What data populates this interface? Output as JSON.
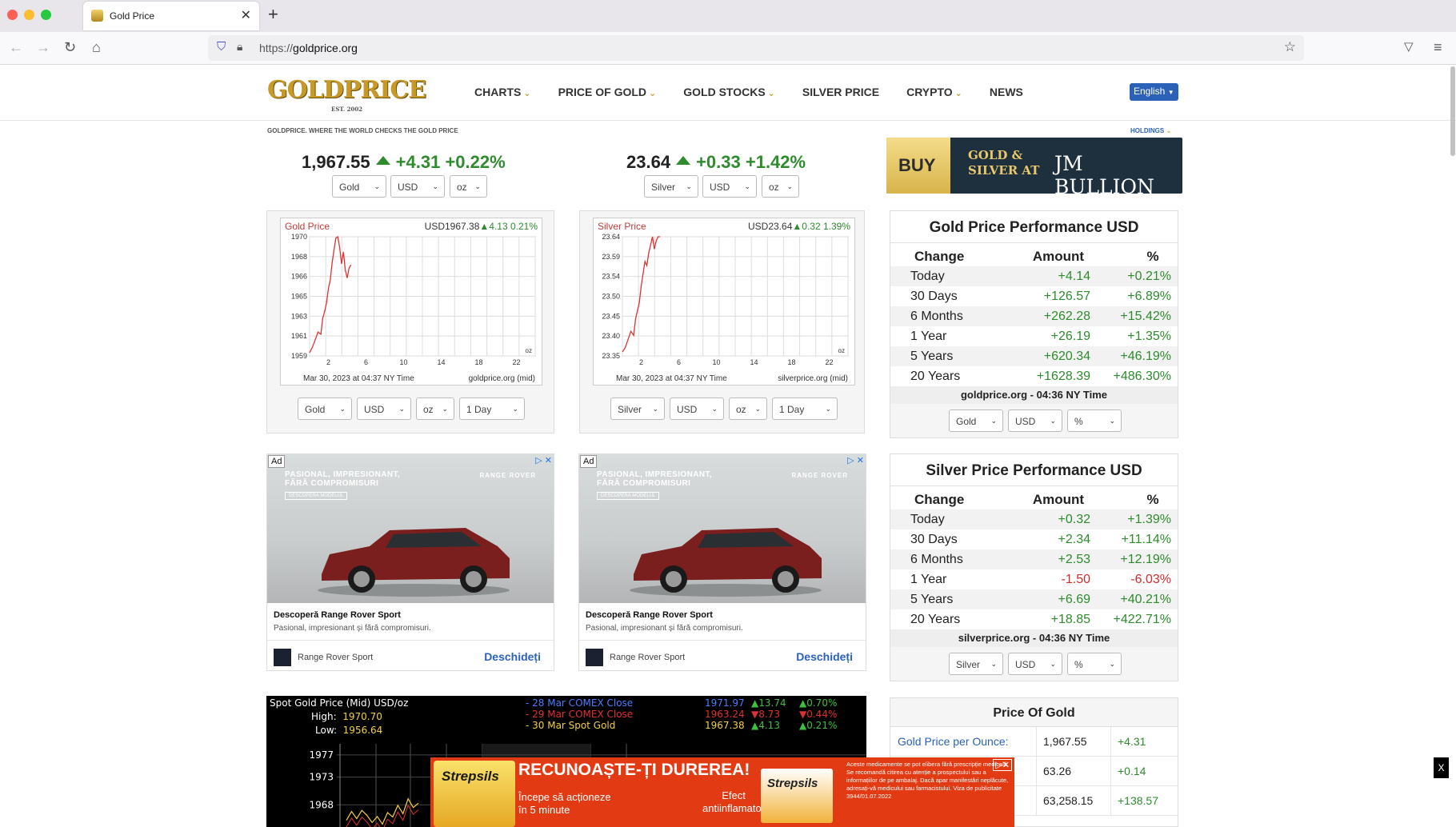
{
  "browser": {
    "tab_title": "Gold Price",
    "url_prefix": "https://",
    "url_host": "goldprice.org"
  },
  "header": {
    "logo": "GOLDPRICE",
    "logo_est": "EST. 2002",
    "nav": [
      "CHARTS",
      "PRICE OF GOLD",
      "GOLD STOCKS",
      "SILVER PRICE",
      "CRYPTO",
      "NEWS"
    ],
    "language": "English",
    "tagline": "GOLDPRICE. WHERE THE WORLD CHECKS THE GOLD PRICE",
    "holdings": "HOLDINGS"
  },
  "gold_ticker": {
    "price": "1,967.55",
    "change": "+4.31",
    "pct": "+0.22%",
    "metal": "Gold",
    "currency": "USD",
    "unit": "oz"
  },
  "silver_ticker": {
    "price": "23.64",
    "change": "+0.33",
    "pct": "+1.42%",
    "metal": "Silver",
    "currency": "USD",
    "unit": "oz"
  },
  "banner": {
    "buy": "BUY",
    "line1": "GOLD &",
    "line2": "SILVER AT",
    "brand": "JM BULLION"
  },
  "gold_chart": {
    "title": "Gold Price",
    "quote_prefix": "USD1967.38",
    "quote_change": "4.13",
    "quote_pct": "0.21%",
    "footer_left": "Mar 30, 2023 at 04:37 NY Time",
    "footer_right": "goldprice.org (mid)",
    "unit_tag": "oz",
    "sel_metal": "Gold",
    "sel_currency": "USD",
    "sel_unit": "oz",
    "sel_range": "1 Day"
  },
  "silver_chart": {
    "title": "Silver Price",
    "quote_prefix": "USD23.64",
    "quote_change": "0.32",
    "quote_pct": "1.39%",
    "footer_left": "Mar 30, 2023 at 04:37 NY Time",
    "footer_right": "silverprice.org (mid)",
    "unit_tag": "oz",
    "sel_metal": "Silver",
    "sel_currency": "USD",
    "sel_unit": "oz",
    "sel_range": "1 Day"
  },
  "chart_data": [
    {
      "type": "line",
      "title": "Gold Price",
      "xlabel": "",
      "ylabel": "",
      "x_ticks": [
        "2",
        "6",
        "10",
        "14",
        "18",
        "22"
      ],
      "y_ticks": [
        "1970",
        "1968",
        "1966",
        "1965",
        "1963",
        "1961",
        "1959"
      ],
      "ylim": [
        1959,
        1970
      ],
      "xlim": [
        0,
        24
      ],
      "series": [
        {
          "x": [
            0,
            0.3,
            0.6,
            0.9,
            1.2,
            1.4,
            1.6,
            1.8,
            2.0,
            2.2,
            2.4,
            2.6,
            2.8,
            3.0,
            3.2,
            3.4,
            3.6,
            3.8,
            4.0,
            4.2,
            4.4
          ],
          "y": [
            1959.3,
            1959.8,
            1960.5,
            1961.2,
            1961.0,
            1962.5,
            1963.1,
            1963.9,
            1965.2,
            1966.0,
            1967.6,
            1968.8,
            1969.9,
            1970.2,
            1969.0,
            1967.5,
            1968.6,
            1966.9,
            1966.2,
            1967.1,
            1967.4
          ]
        }
      ]
    },
    {
      "type": "line",
      "title": "Silver Price",
      "xlabel": "",
      "ylabel": "",
      "x_ticks": [
        "2",
        "6",
        "10",
        "14",
        "18",
        "22"
      ],
      "y_ticks": [
        "23.64",
        "23.59",
        "23.54",
        "23.50",
        "23.45",
        "23.40",
        "23.35"
      ],
      "ylim": [
        23.35,
        23.64
      ],
      "xlim": [
        0,
        24
      ],
      "series": [
        {
          "x": [
            0,
            0.3,
            0.6,
            0.9,
            1.2,
            1.4,
            1.6,
            1.8,
            2.0,
            2.2,
            2.4,
            2.6,
            2.8,
            3.0,
            3.2,
            3.4,
            3.6,
            3.8,
            4.0
          ],
          "y": [
            23.36,
            23.37,
            23.39,
            23.41,
            23.4,
            23.44,
            23.46,
            23.48,
            23.52,
            23.55,
            23.58,
            23.57,
            23.6,
            23.62,
            23.64,
            23.61,
            23.63,
            23.64,
            23.64
          ]
        }
      ]
    },
    {
      "type": "line",
      "title": "Spot Gold Price (Mid) USD/oz",
      "y_ticks": [
        "1977",
        "1973",
        "1968"
      ],
      "ylim": [
        1964,
        1979
      ],
      "series": [
        {
          "name": "30 Mar Spot Gold",
          "x": [
            0,
            1,
            2,
            3,
            4,
            5,
            6,
            7,
            8,
            9,
            10,
            11,
            12,
            13,
            14
          ],
          "y": [
            1965.2,
            1966.8,
            1965.5,
            1967.0,
            1966.1,
            1964.8,
            1965.9,
            1964.5,
            1966.6,
            1965.8,
            1967.9,
            1966.4,
            1969.1,
            1967.5,
            1968.3
          ]
        }
      ]
    }
  ],
  "ads": [
    {
      "label": "Ad",
      "slogan1": "PASIONAL, IMPRESIONANT,",
      "slogan2": "FĂRĂ COMPROMISURI",
      "small_btn": "DESCOPERĂ MODELUL",
      "brand": "RANGE ROVER",
      "headline": "Descoperă Range Rover Sport",
      "desc": "Pasional, impresionant și fără compromisuri.",
      "advertiser": "Range Rover Sport",
      "cta": "Deschideți"
    },
    {
      "label": "Ad",
      "slogan1": "PASIONAL, IMPRESIONANT,",
      "slogan2": "FĂRĂ COMPROMISURI",
      "small_btn": "DESCOPERĂ MODELUL",
      "brand": "RANGE ROVER",
      "headline": "Descoperă Range Rover Sport",
      "desc": "Pasional, impresionant și fără compromisuri.",
      "advertiser": "Range Rover Sport",
      "cta": "Deschideți"
    }
  ],
  "gold_perf": {
    "title": "Gold Price Performance USD",
    "headers": [
      "Change",
      "Amount",
      "%"
    ],
    "rows": [
      {
        "label": "Today",
        "amount": "+4.14",
        "pct": "+0.21%",
        "sign": "pos"
      },
      {
        "label": "30 Days",
        "amount": "+126.57",
        "pct": "+6.89%",
        "sign": "pos"
      },
      {
        "label": "6 Months",
        "amount": "+262.28",
        "pct": "+15.42%",
        "sign": "pos"
      },
      {
        "label": "1 Year",
        "amount": "+26.19",
        "pct": "+1.35%",
        "sign": "pos"
      },
      {
        "label": "5 Years",
        "amount": "+620.34",
        "pct": "+46.19%",
        "sign": "pos"
      },
      {
        "label": "20 Years",
        "amount": "+1628.39",
        "pct": "+486.30%",
        "sign": "pos"
      }
    ],
    "footer": "goldprice.org - 04:36 NY Time",
    "sel_metal": "Gold",
    "sel_currency": "USD",
    "sel_mode": "%"
  },
  "silver_perf": {
    "title": "Silver Price Performance USD",
    "headers": [
      "Change",
      "Amount",
      "%"
    ],
    "rows": [
      {
        "label": "Today",
        "amount": "+0.32",
        "pct": "+1.39%",
        "sign": "pos"
      },
      {
        "label": "30 Days",
        "amount": "+2.34",
        "pct": "+11.14%",
        "sign": "pos"
      },
      {
        "label": "6 Months",
        "amount": "+2.53",
        "pct": "+12.19%",
        "sign": "pos"
      },
      {
        "label": "1 Year",
        "amount": "-1.50",
        "pct": "-6.03%",
        "sign": "neg"
      },
      {
        "label": "5 Years",
        "amount": "+6.69",
        "pct": "+40.21%",
        "sign": "pos"
      },
      {
        "label": "20 Years",
        "amount": "+18.85",
        "pct": "+422.71%",
        "sign": "pos"
      }
    ],
    "footer": "silverprice.org - 04:36 NY Time",
    "sel_metal": "Silver",
    "sel_currency": "USD",
    "sel_mode": "%"
  },
  "price_of_gold": {
    "title": "Price Of Gold",
    "rows": [
      {
        "label": "Gold Price per Ounce:",
        "value": "1,967.55",
        "change": "+4.31"
      },
      {
        "label": "",
        "value": "63.26",
        "change": "+0.14"
      },
      {
        "label": "",
        "value": "63,258.15",
        "change": "+138.57"
      }
    ]
  },
  "spot": {
    "title": "Spot Gold Price (Mid) USD/oz",
    "high_label": "High:",
    "high": "1970.70",
    "low_label": "Low:",
    "low": "1956.64",
    "legend": [
      {
        "label": "- 28 Mar COMEX Close",
        "value": "1971.97",
        "chg": "13.74",
        "pct": "0.70%",
        "color": "#4a7dff",
        "dir": "up"
      },
      {
        "label": "- 29 Mar COMEX Close",
        "value": "1963.24",
        "chg": "8.73",
        "pct": "0.44%",
        "color": "#e03030",
        "dir": "down"
      },
      {
        "label": "- 30 Mar Spot Gold",
        "value": "1967.38",
        "chg": "4.13",
        "pct": "0.21%",
        "color": "#f4d03f",
        "dir": "up"
      }
    ]
  },
  "bottom_ad": {
    "logo": "Strepsils",
    "headline": "RECUNOAȘTE-ȚI DUREREA!",
    "sub1": "Începe să acționeze",
    "sub2": "în 5 minute",
    "effect1": "Efect",
    "effect2": "antiinflamator",
    "logo2": "Strepsils",
    "disclaimer": "Aceste medicamente se pot elibera fără prescripție medicală. Se recomandă citirea cu atenție a prospectului sau a informațiilor de pe ambalaj. Dacă apar manifestări neplăcute, adresați-vă medicului sau farmacistului. Viza de publicitate 3944/01.07.2022",
    "close": "X"
  },
  "colors": {
    "gold": "#c79a28",
    "up": "#2e8b2e",
    "down": "#d32b2b",
    "link": "#2b62b8"
  }
}
